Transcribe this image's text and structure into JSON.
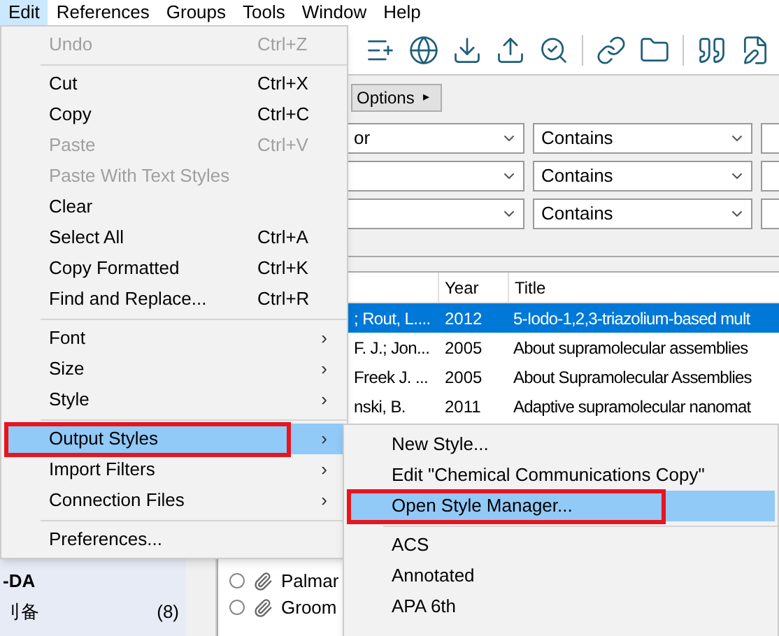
{
  "menu_bar": [
    {
      "label": "Edit",
      "selected": true
    },
    {
      "label": "References",
      "selected": false
    },
    {
      "label": "Groups",
      "selected": false
    },
    {
      "label": "Tools",
      "selected": false
    },
    {
      "label": "Window",
      "selected": false
    },
    {
      "label": "Help",
      "selected": false
    }
  ],
  "search": {
    "options_button": "Options",
    "options_arrow": "▸",
    "rows": [
      {
        "field": "or",
        "operator": "Contains"
      },
      {
        "field": "",
        "operator": "Contains"
      },
      {
        "field": "",
        "operator": "Contains"
      }
    ]
  },
  "table": {
    "columns": [
      "Year",
      "Title"
    ],
    "rows": [
      {
        "author": "; Rout, L....",
        "year": "2012",
        "title": "5-Iodo-1,2,3-triazolium-based mult",
        "selected": true
      },
      {
        "author": "F. J.; Jon...",
        "year": "2005",
        "title": "About supramolecular assemblies",
        "selected": false
      },
      {
        "author": "Freek J. ...",
        "year": "2005",
        "title": "About Supramolecular Assemblies",
        "selected": false
      },
      {
        "author": "nski, B.",
        "year": "2011",
        "title": "Adaptive supramolecular nanomat",
        "selected": false
      }
    ],
    "lower_rows": [
      {
        "author": "Palmar"
      },
      {
        "author": "Groom"
      }
    ]
  },
  "sidebar": {
    "heading": "-DA",
    "items": [
      {
        "label": "刂备",
        "count": "(8)"
      }
    ]
  },
  "edit_menu": [
    {
      "kind": "item",
      "label": "Undo",
      "shortcut": "Ctrl+Z",
      "disabled": true
    },
    {
      "kind": "separator"
    },
    {
      "kind": "item",
      "label": "Cut",
      "shortcut": "Ctrl+X",
      "disabled": false
    },
    {
      "kind": "item",
      "label": "Copy",
      "shortcut": "Ctrl+C",
      "disabled": false
    },
    {
      "kind": "item",
      "label": "Paste",
      "shortcut": "Ctrl+V",
      "disabled": true
    },
    {
      "kind": "item",
      "label": "Paste With Text Styles",
      "disabled": true
    },
    {
      "kind": "item",
      "label": "Clear",
      "disabled": false
    },
    {
      "kind": "item",
      "label": "Select All",
      "shortcut": "Ctrl+A",
      "disabled": false
    },
    {
      "kind": "item",
      "label": "Copy Formatted",
      "shortcut": "Ctrl+K",
      "disabled": false
    },
    {
      "kind": "item",
      "label": "Find and Replace...",
      "shortcut": "Ctrl+R",
      "disabled": false
    },
    {
      "kind": "separator"
    },
    {
      "kind": "submenu",
      "label": "Font",
      "arrow": "›",
      "selected": false,
      "boxed": false
    },
    {
      "kind": "submenu",
      "label": "Size",
      "arrow": "›",
      "selected": false,
      "boxed": false
    },
    {
      "kind": "submenu",
      "label": "Style",
      "arrow": "›",
      "selected": false,
      "boxed": false
    },
    {
      "kind": "separator"
    },
    {
      "kind": "submenu",
      "label": "Output Styles",
      "arrow": "›",
      "selected": true,
      "boxed": true
    },
    {
      "kind": "submenu",
      "label": "Import Filters",
      "arrow": "›",
      "selected": false,
      "boxed": false
    },
    {
      "kind": "submenu",
      "label": "Connection Files",
      "arrow": "›",
      "selected": false,
      "boxed": false
    },
    {
      "kind": "separator"
    },
    {
      "kind": "item",
      "label": "Preferences...",
      "disabled": false
    }
  ],
  "output_styles_menu": [
    {
      "kind": "item",
      "label": "New Style...",
      "selected": false,
      "boxed": false
    },
    {
      "kind": "item",
      "label": "Edit \"Chemical Communications Copy\"",
      "selected": false,
      "boxed": false
    },
    {
      "kind": "item",
      "label": "Open Style Manager...",
      "selected": true,
      "boxed": true
    },
    {
      "kind": "separator"
    },
    {
      "kind": "item",
      "label": "ACS",
      "selected": false,
      "boxed": false
    },
    {
      "kind": "item",
      "label": "Annotated",
      "selected": false,
      "boxed": false
    },
    {
      "kind": "item",
      "label": "APA 6th",
      "selected": false,
      "boxed": false
    }
  ]
}
